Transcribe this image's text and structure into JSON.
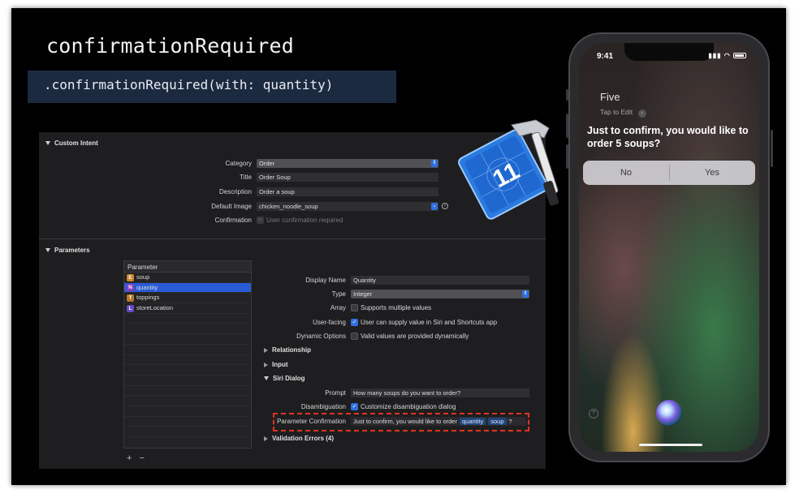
{
  "slide": {
    "title": "confirmationRequired",
    "code": ".confirmationRequired(with: quantity)"
  },
  "xcode": {
    "custom_intent": {
      "header": "Custom Intent",
      "category_label": "Category",
      "category_value": "Order",
      "title_label": "Title",
      "title_value": "Order Soup",
      "description_label": "Description",
      "description_value": "Order a soup",
      "default_image_label": "Default Image",
      "default_image_value": "chicken_noodle_soup",
      "confirmation_label": "Confirmation",
      "confirmation_text": "User confirmation required"
    },
    "parameters": {
      "header": "Parameters",
      "table_header": "Parameter",
      "items": [
        {
          "badge": "E",
          "name": "soup",
          "color": "#c9822a"
        },
        {
          "badge": "N",
          "name": "quantity",
          "color": "#8a3fb8"
        },
        {
          "badge": "T",
          "name": "toppings",
          "color": "#b57a2a"
        },
        {
          "badge": "L",
          "name": "storeLocation",
          "color": "#6a48c8"
        }
      ],
      "add_symbol": "+",
      "remove_symbol": "−"
    },
    "detail": {
      "display_name_label": "Display Name",
      "display_name_value": "Quantity",
      "type_label": "Type",
      "type_value": "Integer",
      "array_label": "Array",
      "array_text": "Supports multiple values",
      "user_facing_label": "User-facing",
      "user_facing_text": "User can supply value in Siri and Shortcuts app",
      "dynamic_label": "Dynamic Options",
      "dynamic_text": "Valid values are provided dynamically",
      "relationship": "Relationship",
      "input": "Input",
      "siri_dialog": "Siri Dialog",
      "prompt_label": "Prompt",
      "prompt_value": "How many soups do you want to order?",
      "disambiguation_label": "Disambiguation",
      "disambiguation_text": "Customize disambiguation dialog",
      "param_confirm_label": "Parameter Confirmation",
      "param_confirm_text": "Just to confirm, you would like to order",
      "token_quantity": "quantity",
      "token_soup": "soup",
      "param_confirm_suffix": "?",
      "validation_errors": "Validation Errors (4)"
    },
    "icon": {
      "version": "11",
      "name": "xcode-icon"
    }
  },
  "phone": {
    "time": "9:41",
    "query": "Five",
    "tap_to_edit": "Tap to Edit",
    "response": "Just to confirm, you would like to order 5 soups?",
    "no_label": "No",
    "yes_label": "Yes",
    "help": "?"
  },
  "colors": {
    "accent": "#2f6fe0",
    "highlight": "#e0341f",
    "selection": "#2a5bd7"
  }
}
